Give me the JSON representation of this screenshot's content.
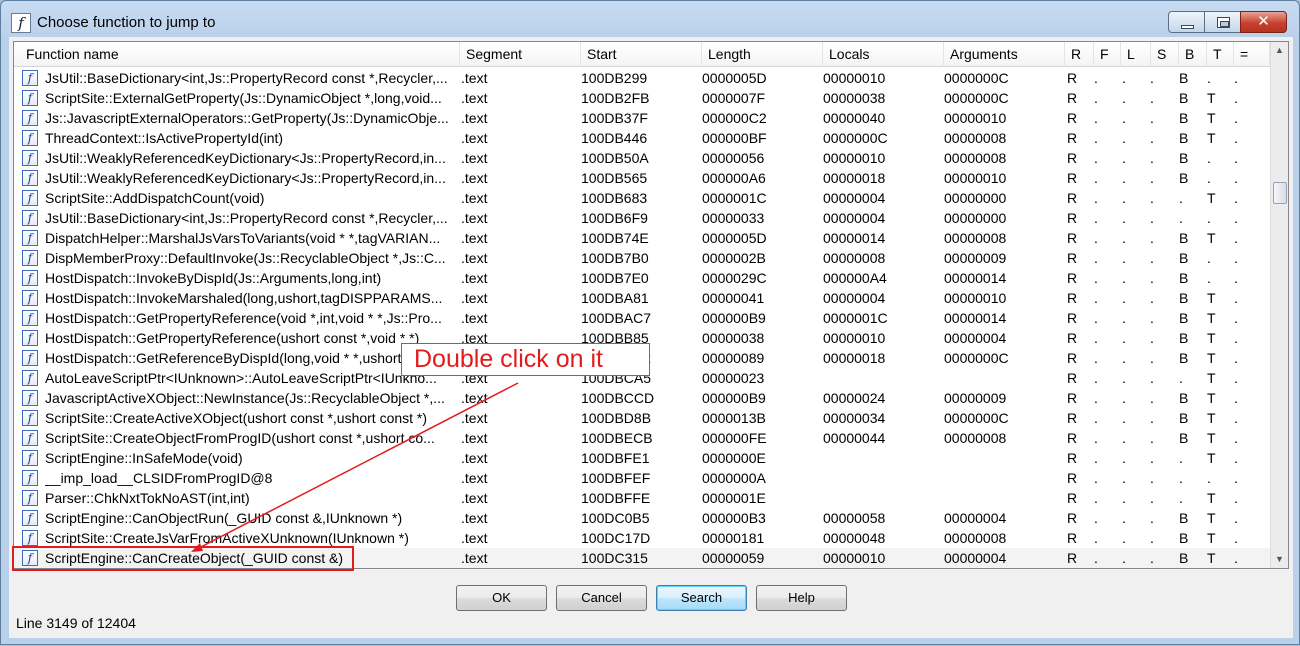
{
  "window": {
    "title": "Choose function to jump to",
    "app_icon": "italic-f-function-icon",
    "controls": {
      "minimize_icon": "minimize-icon",
      "maximize_icon": "maximize-icon",
      "close_label": "✕"
    }
  },
  "table": {
    "columns": [
      "Function name",
      "Segment",
      "Start",
      "Length",
      "Locals",
      "Arguments",
      "R",
      "F",
      "L",
      "S",
      "B",
      "T",
      "="
    ],
    "rows": [
      [
        "JsUtil::BaseDictionary<int,Js::PropertyRecord const *,Recycler,...",
        ".text",
        "100DB299",
        "0000005D",
        "00000010",
        "0000000C",
        "R",
        ".",
        ".",
        ".",
        "B",
        ".",
        "."
      ],
      [
        "ScriptSite::ExternalGetProperty(Js::DynamicObject *,long,void...",
        ".text",
        "100DB2FB",
        "0000007F",
        "00000038",
        "0000000C",
        "R",
        ".",
        ".",
        ".",
        "B",
        "T",
        "."
      ],
      [
        "Js::JavascriptExternalOperators::GetProperty(Js::DynamicObje...",
        ".text",
        "100DB37F",
        "000000C2",
        "00000040",
        "00000010",
        "R",
        ".",
        ".",
        ".",
        "B",
        "T",
        "."
      ],
      [
        "ThreadContext::IsActivePropertyId(int)",
        ".text",
        "100DB446",
        "000000BF",
        "0000000C",
        "00000008",
        "R",
        ".",
        ".",
        ".",
        "B",
        "T",
        "."
      ],
      [
        "JsUtil::WeaklyReferencedKeyDictionary<Js::PropertyRecord,in...",
        ".text",
        "100DB50A",
        "00000056",
        "00000010",
        "00000008",
        "R",
        ".",
        ".",
        ".",
        "B",
        ".",
        "."
      ],
      [
        "JsUtil::WeaklyReferencedKeyDictionary<Js::PropertyRecord,in...",
        ".text",
        "100DB565",
        "000000A6",
        "00000018",
        "00000010",
        "R",
        ".",
        ".",
        ".",
        "B",
        ".",
        "."
      ],
      [
        "ScriptSite::AddDispatchCount(void)",
        ".text",
        "100DB683",
        "0000001C",
        "00000004",
        "00000000",
        "R",
        ".",
        ".",
        ".",
        ".",
        "T",
        "."
      ],
      [
        "JsUtil::BaseDictionary<int,Js::PropertyRecord const *,Recycler,...",
        ".text",
        "100DB6F9",
        "00000033",
        "00000004",
        "00000000",
        "R",
        ".",
        ".",
        ".",
        ".",
        ".",
        "."
      ],
      [
        "DispatchHelper::MarshalJsVarsToVariants(void * *,tagVARIAN...",
        ".text",
        "100DB74E",
        "0000005D",
        "00000014",
        "00000008",
        "R",
        ".",
        ".",
        ".",
        "B",
        "T",
        "."
      ],
      [
        "DispMemberProxy::DefaultInvoke(Js::RecyclableObject *,Js::C...",
        ".text",
        "100DB7B0",
        "0000002B",
        "00000008",
        "00000009",
        "R",
        ".",
        ".",
        ".",
        "B",
        ".",
        "."
      ],
      [
        "HostDispatch::InvokeByDispId(Js::Arguments,long,int)",
        ".text",
        "100DB7E0",
        "0000029C",
        "000000A4",
        "00000014",
        "R",
        ".",
        ".",
        ".",
        "B",
        ".",
        "."
      ],
      [
        "HostDispatch::InvokeMarshaled(long,ushort,tagDISPPARAMS...",
        ".text",
        "100DBA81",
        "00000041",
        "00000004",
        "00000010",
        "R",
        ".",
        ".",
        ".",
        "B",
        "T",
        "."
      ],
      [
        "HostDispatch::GetPropertyReference(void *,int,void * *,Js::Pro...",
        ".text",
        "100DBAC7",
        "000000B9",
        "0000001C",
        "00000014",
        "R",
        ".",
        ".",
        ".",
        "B",
        "T",
        "."
      ],
      [
        "HostDispatch::GetPropertyReference(ushort const *,void * *)",
        ".text",
        "100DBB85",
        "00000038",
        "00000010",
        "00000004",
        "R",
        ".",
        ".",
        ".",
        "B",
        "T",
        "."
      ],
      [
        "HostDispatch::GetReferenceByDispId(long,void * *,ushort const *)",
        ".text",
        "100DBBC2",
        "00000089",
        "00000018",
        "0000000C",
        "R",
        ".",
        ".",
        ".",
        "B",
        "T",
        "."
      ],
      [
        "AutoLeaveScriptPtr<IUnknown>::AutoLeaveScriptPtr<IUnkno...",
        ".text",
        "100DBCA5",
        "00000023",
        "",
        "",
        "R",
        ".",
        ".",
        ".",
        ".",
        "T",
        "."
      ],
      [
        "JavascriptActiveXObject::NewInstance(Js::RecyclableObject *,...",
        ".text",
        "100DBCCD",
        "000000B9",
        "00000024",
        "00000009",
        "R",
        ".",
        ".",
        ".",
        "B",
        "T",
        "."
      ],
      [
        "ScriptSite::CreateActiveXObject(ushort const *,ushort const *)",
        ".text",
        "100DBD8B",
        "0000013B",
        "00000034",
        "0000000C",
        "R",
        ".",
        ".",
        ".",
        "B",
        "T",
        "."
      ],
      [
        "ScriptSite::CreateObjectFromProgID(ushort const *,ushort co...",
        ".text",
        "100DBECB",
        "000000FE",
        "00000044",
        "00000008",
        "R",
        ".",
        ".",
        ".",
        "B",
        "T",
        "."
      ],
      [
        "ScriptEngine::InSafeMode(void)",
        ".text",
        "100DBFE1",
        "0000000E",
        "",
        "",
        "R",
        ".",
        ".",
        ".",
        ".",
        "T",
        "."
      ],
      [
        "__imp_load__CLSIDFromProgID@8",
        ".text",
        "100DBFEF",
        "0000000A",
        "",
        "",
        "R",
        ".",
        ".",
        ".",
        ".",
        ".",
        "."
      ],
      [
        "Parser::ChkNxtTokNoAST(int,int)",
        ".text",
        "100DBFFE",
        "0000001E",
        "",
        "",
        "R",
        ".",
        ".",
        ".",
        ".",
        "T",
        "."
      ],
      [
        "ScriptEngine::CanObjectRun(_GUID const &,IUnknown *)",
        ".text",
        "100DC0B5",
        "000000B3",
        "00000058",
        "00000004",
        "R",
        ".",
        ".",
        ".",
        "B",
        "T",
        "."
      ],
      [
        "ScriptSite::CreateJsVarFromActiveXUnknown(IUnknown *)",
        ".text",
        "100DC17D",
        "00000181",
        "00000048",
        "00000008",
        "R",
        ".",
        ".",
        ".",
        "B",
        "T",
        "."
      ],
      [
        "ScriptEngine::CanCreateObject(_GUID const &)",
        ".text",
        "100DC315",
        "00000059",
        "00000010",
        "00000004",
        "R",
        ".",
        ".",
        ".",
        "B",
        "T",
        "."
      ]
    ],
    "selected_row": 24,
    "row_icon": "function-f-icon"
  },
  "buttons": {
    "ok": "OK",
    "cancel": "Cancel",
    "search": "Search",
    "help": "Help"
  },
  "status": "Line 3149 of 12404",
  "annotation": {
    "text": "Double click on it",
    "color": "#e21c1c"
  },
  "colors": {
    "accent_red": "#e21c1c",
    "title_bg": "#b9d0ea",
    "default_button": "#a7d9f5"
  }
}
